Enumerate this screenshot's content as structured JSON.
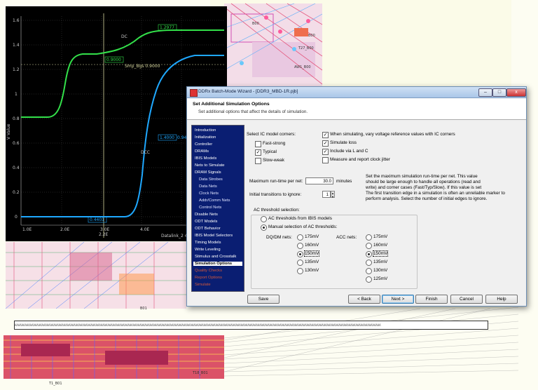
{
  "pcb": {
    "labels": [
      "B00",
      "B00",
      "T27_B00",
      "AW1_B00",
      "T18_B01",
      "B01",
      "T1_B01"
    ],
    "netbar_text": "AAAAAAAAAAAAAAAAAAAAAAAAAAAAAAAAAAAAAAAAAAAAAAAAAAAAAAAAAAAAAAAAAAAAAAAAAAAAAAAAAAAAAAAAAAAAAAAAAAAAAAAAAAAAAAAAAAAAAAAAAAAAAAAAAAAAAAAAAAAAAAAAAAAAAAAAAAAAAAAAAAAAAAAAAAAAAAAAAAAAAAAAAAAAAAAAAAAAAAAAAAAAAAAAAAAAAAAAA"
  },
  "scope": {
    "y_axis_label": "V Value",
    "y_ticks": [
      "1.6",
      "1.4",
      "1.2",
      "1",
      "0.8",
      "0.6",
      "0.4",
      "0.2",
      "0"
    ],
    "x_ticks": [
      "1.0E",
      "2.0E",
      "3.0E",
      "4.0E"
    ],
    "markers": {
      "dc_top": "DC",
      "dc_top_value": "1.2977",
      "dc_mid": "DCC",
      "dc_mid_value": "1.4000",
      "marker_a": "0.9000",
      "marker_b": "Smp_Bgs 0.9000",
      "marker_c": "0.4401",
      "marker_d": "0.9400",
      "bottom_readout": "Datalink_2 46.0E",
      "rule_label": "2.2E"
    },
    "colors": {
      "green": "#33e04a",
      "cyan": "#1fa8ff",
      "cursor": "#d8d8a0"
    }
  },
  "wizard": {
    "title": "DDRx Batch-Mode Wizard - [DDR3_MBD-1R.pjb]",
    "header_title": "Set Additional Simulation Options",
    "header_subtitle": "Set additional options that affect the details of simulation.",
    "nav": [
      {
        "label": "Introduction",
        "state": "normal"
      },
      {
        "label": "Initialization",
        "state": "normal"
      },
      {
        "label": "Controller",
        "state": "normal"
      },
      {
        "label": "DRAMs",
        "state": "normal"
      },
      {
        "label": "IBIS Models",
        "state": "normal"
      },
      {
        "label": "Nets to Simulate",
        "state": "normal"
      },
      {
        "label": "DRAM Signals",
        "state": "normal"
      },
      {
        "label": "Data Strobes",
        "state": "sub"
      },
      {
        "label": "Data Nets",
        "state": "sub"
      },
      {
        "label": "Clock Nets",
        "state": "sub"
      },
      {
        "label": "Addr/Comm Nets",
        "state": "sub"
      },
      {
        "label": "Control Nets",
        "state": "sub"
      },
      {
        "label": "Disable Nets",
        "state": "normal"
      },
      {
        "label": "ODT Models",
        "state": "normal"
      },
      {
        "label": "ODT Behavior",
        "state": "normal"
      },
      {
        "label": "IBIS Model Selectors",
        "state": "normal"
      },
      {
        "label": "Timing Models",
        "state": "normal"
      },
      {
        "label": "Write Leveling",
        "state": "normal"
      },
      {
        "label": "Stimulus and Crosstalk",
        "state": "normal"
      },
      {
        "label": "Simulation Options",
        "state": "selected"
      },
      {
        "label": "Quality Checks",
        "state": "disabled"
      },
      {
        "label": "Report Options",
        "state": "disabled"
      },
      {
        "label": "Simulate",
        "state": "disabled"
      }
    ],
    "ic_corners_label": "Select IC model corners:",
    "corners": [
      {
        "label": "Fast-strong",
        "checked": false
      },
      {
        "label": "Typical",
        "checked": true
      },
      {
        "label": "Slow-weak",
        "checked": false
      }
    ],
    "options": [
      {
        "label": "When simulating, vary voltage reference values with IC corners",
        "checked": true
      },
      {
        "label": "Simulate loss",
        "checked": true
      },
      {
        "label": "Include via L and C",
        "checked": true
      },
      {
        "label": "Measure and report clock jitter",
        "checked": false
      }
    ],
    "max_runtime_label": "Maximum run-time per net:",
    "max_runtime_value": "30.0",
    "max_runtime_unit": "minutes",
    "max_runtime_help": [
      "Set the maximum simulation run-time per net.  This value",
      "should be large enough to handle all operations (read and",
      "write) and corner cases (Fast/Typ/Slow).  If this value is set"
    ],
    "transitions_label": "Initial transitions to ignore:",
    "transitions_value": "1",
    "transitions_help": [
      "The first transition edge in a simulation is often an unreliable marker to",
      "perform analysis.  Select the number of initial edges to ignore."
    ],
    "ac_threshold_label": "AC threshold selection:",
    "ac_from_ibis": "AC thresholds from IBIS models",
    "ac_manual": "Manual selection of AC thresholds:",
    "dqdm_label": "DQ/DM nets:",
    "acc_label": "ACC nets:",
    "dqdm_values": [
      "175mV",
      "160mV",
      "150mV",
      "135mV",
      "130mV"
    ],
    "dqdm_selected": 2,
    "acc_values": [
      "175mV",
      "160mV",
      "150mV",
      "135mV",
      "130mV",
      "125mV"
    ],
    "acc_selected": 2,
    "buttons": {
      "save": "Save",
      "back": "< Back",
      "next": "Next >",
      "finish": "Finish",
      "cancel": "Cancel",
      "help": "Help"
    },
    "window_buttons": {
      "minimize": "–",
      "maximize": "□",
      "close": "x"
    }
  }
}
